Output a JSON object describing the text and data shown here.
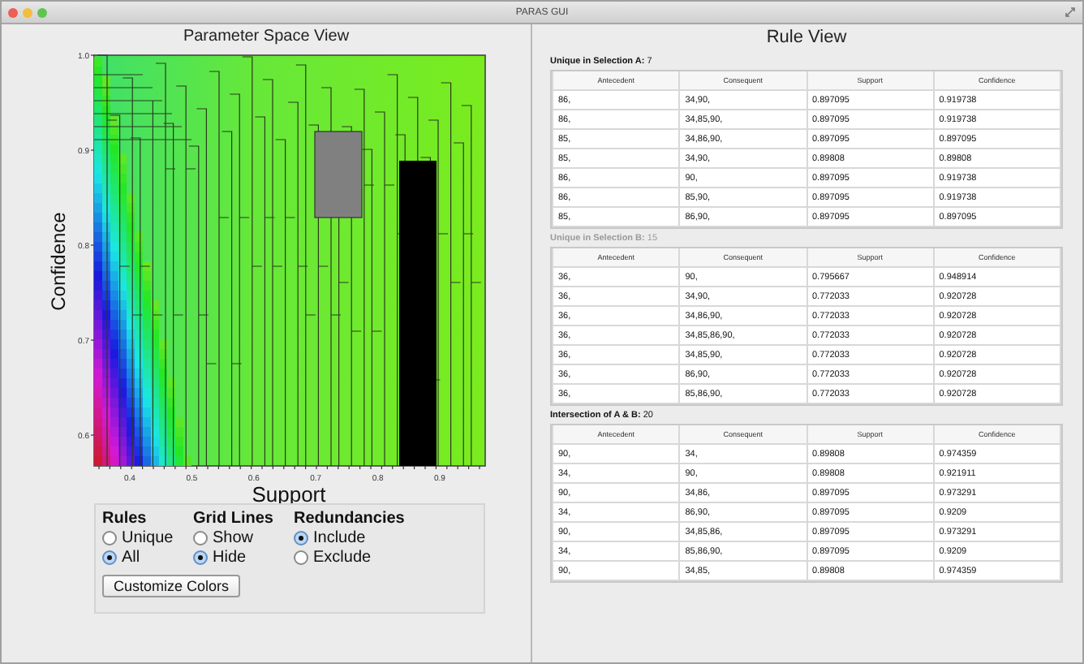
{
  "window": {
    "title": "PARAS GUI"
  },
  "parameter_space_view": {
    "title": "Parameter Space View",
    "x_axis": {
      "label": "Support",
      "ticks": [
        "0.4",
        "0.5",
        "0.6",
        "0.7",
        "0.8",
        "0.9"
      ]
    },
    "y_axis": {
      "label": "Confidence",
      "ticks": [
        "1.0",
        "0.9",
        "0.8",
        "0.7",
        "0.6"
      ]
    },
    "options": [
      {
        "title": "Rules",
        "items": [
          {
            "label": "Unique",
            "selected": false
          },
          {
            "label": "All",
            "selected": true
          }
        ]
      },
      {
        "title": "Grid Lines",
        "items": [
          {
            "label": "Show",
            "selected": false
          },
          {
            "label": "Hide",
            "selected": true
          }
        ]
      },
      {
        "title": "Redundancies",
        "items": [
          {
            "label": "Include",
            "selected": true
          },
          {
            "label": "Exclude",
            "selected": false
          }
        ]
      }
    ],
    "button": "Customize Colors"
  },
  "rule_view": {
    "title": "Rule View",
    "sections": [
      {
        "label": "**Unique in Selection A:** 7",
        "dimmed": false,
        "columns": [
          "Antecedent",
          "Consequent",
          "Support",
          "Confidence"
        ],
        "rows": [
          [
            "86,",
            "34,90,",
            "0.897095",
            "0.919738"
          ],
          [
            "86,",
            "34,85,90,",
            "0.897095",
            "0.919738"
          ],
          [
            "85,",
            "34,86,90,",
            "0.897095",
            "0.897095"
          ],
          [
            "85,",
            "34,90,",
            "0.89808",
            "0.89808"
          ],
          [
            "86,",
            "90,",
            "0.897095",
            "0.919738"
          ],
          [
            "86,",
            "85,90,",
            "0.897095",
            "0.919738"
          ],
          [
            "85,",
            "86,90,",
            "0.897095",
            "0.897095"
          ]
        ]
      },
      {
        "label": "**Unique in Selection B:** 15",
        "dimmed": true,
        "columns": [
          "Antecedent",
          "Consequent",
          "Support",
          "Confidence"
        ],
        "rows": [
          [
            "36,",
            "90,",
            "0.795667",
            "0.948914"
          ],
          [
            "36,",
            "34,90,",
            "0.772033",
            "0.920728"
          ],
          [
            "36,",
            "34,86,90,",
            "0.772033",
            "0.920728"
          ],
          [
            "36,",
            "34,85,86,90,",
            "0.772033",
            "0.920728"
          ],
          [
            "36,",
            "34,85,90,",
            "0.772033",
            "0.920728"
          ],
          [
            "36,",
            "86,90,",
            "0.772033",
            "0.920728"
          ],
          [
            "36,",
            "85,86,90,",
            "0.772033",
            "0.920728"
          ]
        ]
      },
      {
        "label": "**Intersection of A & B:** 20",
        "dimmed": false,
        "columns": [
          "Antecedent",
          "Consequent",
          "Support",
          "Confidence"
        ],
        "rows": [
          [
            "90,",
            "34,",
            "0.89808",
            "0.974359"
          ],
          [
            "34,",
            "90,",
            "0.89808",
            "0.921911"
          ],
          [
            "90,",
            "34,86,",
            "0.897095",
            "0.973291"
          ],
          [
            "34,",
            "86,90,",
            "0.897095",
            "0.9209"
          ],
          [
            "90,",
            "34,85,86,",
            "0.897095",
            "0.973291"
          ],
          [
            "34,",
            "85,86,90,",
            "0.897095",
            "0.9209"
          ],
          [
            "90,",
            "34,85,",
            "0.89808",
            "0.974359"
          ]
        ]
      }
    ]
  }
}
